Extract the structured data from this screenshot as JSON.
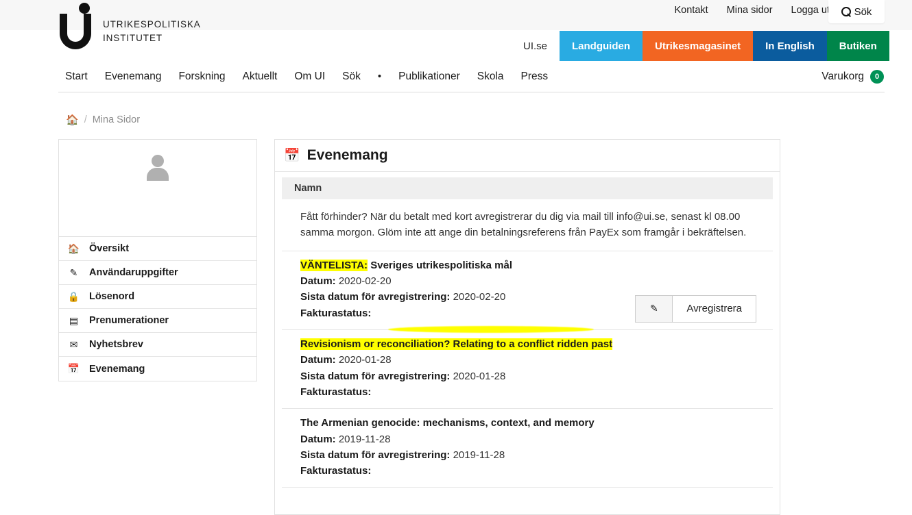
{
  "header": {
    "logo": {
      "line1": "UTRIKESPOLITISKA",
      "line2": "INSTITUTET",
      "icon": "ui-u-logo"
    },
    "util_nav": [
      {
        "label": "Kontakt"
      },
      {
        "label": "Mina sidor"
      },
      {
        "label": "Logga ut"
      }
    ],
    "search_button": {
      "label": "Sök",
      "icon": "search-icon"
    },
    "site_tabs": [
      {
        "label": "UI.se",
        "color": "#ffffff",
        "text_color": "#222222",
        "active": true
      },
      {
        "label": "Landguiden",
        "color": "#29abe2",
        "text_color": "#ffffff",
        "active": false
      },
      {
        "label": "Utrikesmagasinet",
        "color": "#f26522",
        "text_color": "#ffffff",
        "active": false
      },
      {
        "label": "In English",
        "color": "#0b5c9e",
        "text_color": "#ffffff",
        "active": false
      },
      {
        "label": "Butiken",
        "color": "#00854a",
        "text_color": "#ffffff",
        "active": false
      }
    ]
  },
  "main_nav": {
    "items": [
      {
        "label": "Start"
      },
      {
        "label": "Evenemang"
      },
      {
        "label": "Forskning"
      },
      {
        "label": "Aktuellt"
      },
      {
        "label": "Om UI"
      },
      {
        "label": "Sök"
      },
      {
        "label": "•"
      },
      {
        "label": "Publikationer"
      },
      {
        "label": "Skola"
      },
      {
        "label": "Press"
      }
    ],
    "cart": {
      "label": "Varukorg",
      "count": "0",
      "badge_color": "#009156"
    }
  },
  "breadcrumb": {
    "home_icon": "home-icon",
    "separator": "/",
    "current": "Mina Sidor",
    "home_color": "#00a499"
  },
  "sidebar": {
    "avatar": {
      "icon": "user-avatar-placeholder"
    },
    "items": [
      {
        "label": "Översikt",
        "icon": "home-icon",
        "glyph": "⌂"
      },
      {
        "label": "Användaruppgifter",
        "icon": "pencil-icon",
        "glyph": "✎"
      },
      {
        "label": "Lösenord",
        "icon": "lock-icon",
        "glyph": "🔒"
      },
      {
        "label": "Prenumerationer",
        "icon": "credit-card-icon",
        "glyph": "▤"
      },
      {
        "label": "Nyhetsbrev",
        "icon": "envelope-icon",
        "glyph": "✉"
      },
      {
        "label": "Evenemang",
        "icon": "calendar-icon",
        "glyph": "📅"
      }
    ]
  },
  "panel": {
    "icon": "calendar-icon",
    "title": "Evenemang",
    "column_header": "Namn",
    "notice": "Fått förhinder? När du betalt med kort avregistrerar du dig via mail till info@ui.se, senast kl 08.00 samma morgon. Glöm inte att ange din betalningsreferens från PayEx som framgår i bekräftelsen.",
    "labels": {
      "datum": "Datum:",
      "sista_datum": "Sista datum för avregistrering:",
      "fakturastatus": "Fakturastatus:"
    },
    "buttons": {
      "edit_icon": "pencil-icon",
      "edit_glyph": "✎",
      "unregister": "Avregistrera"
    },
    "events": [
      {
        "prefix": "VÄNTELISTA:",
        "prefix_highlighted": true,
        "title": " Sveriges utrikespolitiska mål",
        "title_highlighted": false,
        "datum": "2020-02-20",
        "sista_datum": "2020-02-20",
        "fakturastatus": "",
        "has_buttons": true
      },
      {
        "prefix": "",
        "prefix_highlighted": false,
        "title": "Revisionism or reconciliation? Relating to a conflict ridden past",
        "title_highlighted": true,
        "datum": "2020-01-28",
        "sista_datum": "2020-01-28",
        "fakturastatus": "",
        "has_buttons": false
      },
      {
        "prefix": "",
        "prefix_highlighted": false,
        "title": "The Armenian genocide: mechanisms, context, and memory",
        "title_highlighted": false,
        "datum": "2019-11-28",
        "sista_datum": "2019-11-28",
        "fakturastatus": "",
        "has_buttons": false
      }
    ]
  },
  "colors": {
    "highlight": "#ffff00",
    "teal": "#00a499",
    "green": "#009156"
  }
}
